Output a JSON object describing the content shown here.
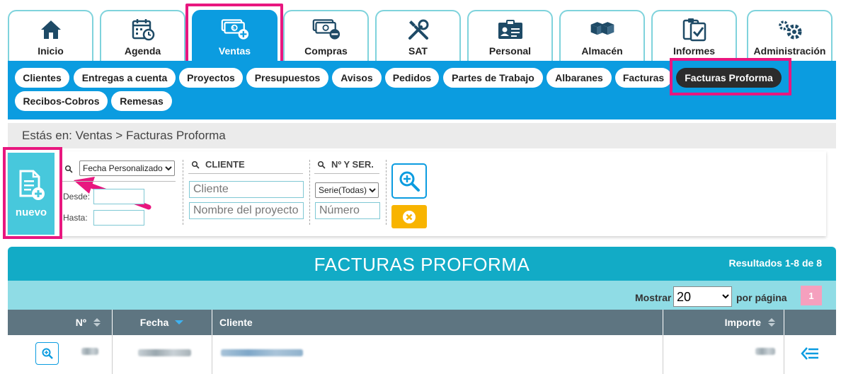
{
  "tabs": [
    {
      "label": "Inicio",
      "icon": "home-icon"
    },
    {
      "label": "Agenda",
      "icon": "calendar-icon"
    },
    {
      "label": "Ventas",
      "icon": "money-plus-icon",
      "active": true
    },
    {
      "label": "Compras",
      "icon": "money-minus-icon"
    },
    {
      "label": "SAT",
      "icon": "tools-icon"
    },
    {
      "label": "Personal",
      "icon": "id-card-icon"
    },
    {
      "label": "Almacén",
      "icon": "boxes-icon"
    },
    {
      "label": "Informes",
      "icon": "clipboard-check-icon"
    },
    {
      "label": "Administración",
      "icon": "gears-icon"
    }
  ],
  "subnav": [
    {
      "label": "Clientes"
    },
    {
      "label": "Entregas a cuenta"
    },
    {
      "label": "Proyectos"
    },
    {
      "label": "Presupuestos"
    },
    {
      "label": "Avisos"
    },
    {
      "label": "Pedidos"
    },
    {
      "label": "Partes de Trabajo"
    },
    {
      "label": "Albaranes"
    },
    {
      "label": "Facturas"
    },
    {
      "label": "Facturas Proforma",
      "active": true
    },
    {
      "label": "Recibos-Cobros"
    },
    {
      "label": "Remesas"
    }
  ],
  "breadcrumb": "Estás en: Ventas > Facturas Proforma",
  "nuevo": {
    "label": "nuevo"
  },
  "filters": {
    "date_type": "Fecha Personalizado",
    "desde_label": "Desde:",
    "hasta_label": "Hasta:",
    "cliente_header": "CLIENTE",
    "cliente_placeholder": "Cliente",
    "proyecto_placeholder": "Nombre del proyecto",
    "serie_header": "Nº Y SER.",
    "serie_value": "Serie(Todas)",
    "numero_placeholder": "Número"
  },
  "results": {
    "title": "FACTURAS PROFORMA",
    "count": "Resultados 1-8 de 8",
    "mostrar": "Mostrar",
    "per_page": "20",
    "por_pagina": "por página",
    "page": "1"
  },
  "table": {
    "headers": {
      "numero": "Nº",
      "fecha": "Fecha",
      "cliente": "Cliente",
      "importe": "Importe"
    }
  },
  "colors": {
    "accent": "#0b9ce0",
    "highlight": "#e8177f",
    "teal": "#12abc6",
    "nuevo": "#47c8dc",
    "clear": "#f8b400"
  }
}
